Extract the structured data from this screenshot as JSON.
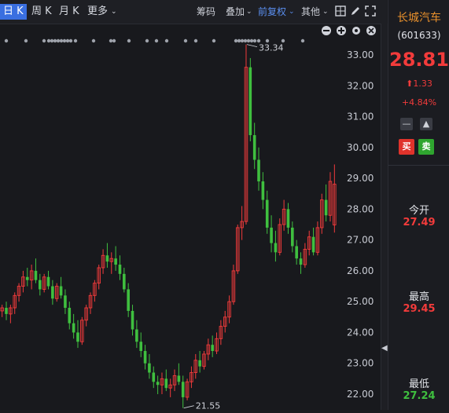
{
  "toolbar": {
    "tabs": [
      "日 K",
      "周 K",
      "月 K",
      "更多"
    ],
    "chips": "筹码",
    "overlay": "叠加",
    "adjust": "前复权",
    "other": "其他"
  },
  "stock": {
    "name": "长城汽车",
    "code": "(601633)",
    "price": "28.81",
    "change": "1.33",
    "change_pct": "+4.84%",
    "buy_label": "买",
    "sell_label": "卖",
    "open_label": "今开",
    "open_value": "27.49",
    "high_label": "最高",
    "high_value": "29.45",
    "low_label": "最低",
    "low_value": "27.24"
  },
  "colors": {
    "up": "#f23b3b",
    "down": "#3fbf3f",
    "accent": "#e8902c",
    "active_tab": "#3a6fe0"
  },
  "chart_data": {
    "type": "candlestick",
    "y_ticks": [
      "33.00",
      "32.00",
      "31.00",
      "30.00",
      "29.00",
      "28.00",
      "27.00",
      "26.00",
      "25.00",
      "24.00",
      "23.00",
      "22.00"
    ],
    "ylim": [
      21.6,
      33.6
    ],
    "max_label": "33.34",
    "min_label": "21.55",
    "candles": [
      [
        24.7,
        24.9,
        24.5,
        24.8
      ],
      [
        24.8,
        25.0,
        24.4,
        24.6
      ],
      [
        24.6,
        24.9,
        24.3,
        24.8
      ],
      [
        24.8,
        25.3,
        24.6,
        25.2
      ],
      [
        25.2,
        25.6,
        25.0,
        25.5
      ],
      [
        25.5,
        26.0,
        25.3,
        25.8
      ],
      [
        25.8,
        26.1,
        25.5,
        25.7
      ],
      [
        25.7,
        26.2,
        25.4,
        26.0
      ],
      [
        26.0,
        26.4,
        25.6,
        25.7
      ],
      [
        25.7,
        25.9,
        25.2,
        25.4
      ],
      [
        25.4,
        25.9,
        25.3,
        25.8
      ],
      [
        25.8,
        26.0,
        25.4,
        25.5
      ],
      [
        25.5,
        25.7,
        24.9,
        25.1
      ],
      [
        25.1,
        25.6,
        25.0,
        25.5
      ],
      [
        25.5,
        25.8,
        25.1,
        25.2
      ],
      [
        25.2,
        25.4,
        24.6,
        24.8
      ],
      [
        24.8,
        25.0,
        24.1,
        24.3
      ],
      [
        24.3,
        24.6,
        23.8,
        24.0
      ],
      [
        24.0,
        24.4,
        23.5,
        23.7
      ],
      [
        23.7,
        24.5,
        23.6,
        24.4
      ],
      [
        24.4,
        24.9,
        24.2,
        24.8
      ],
      [
        24.8,
        25.3,
        24.6,
        25.2
      ],
      [
        25.2,
        25.7,
        25.0,
        25.6
      ],
      [
        25.6,
        26.2,
        25.4,
        26.1
      ],
      [
        26.1,
        26.7,
        25.9,
        26.5
      ],
      [
        26.5,
        26.9,
        26.1,
        26.3
      ],
      [
        26.3,
        26.6,
        25.9,
        26.4
      ],
      [
        26.4,
        26.8,
        26.0,
        26.2
      ],
      [
        26.2,
        26.5,
        25.7,
        25.9
      ],
      [
        25.9,
        26.1,
        25.3,
        25.4
      ],
      [
        25.4,
        25.6,
        24.5,
        24.7
      ],
      [
        24.7,
        24.9,
        23.9,
        24.1
      ],
      [
        24.1,
        24.4,
        23.5,
        23.7
      ],
      [
        23.7,
        24.0,
        23.2,
        23.4
      ],
      [
        23.4,
        23.6,
        22.8,
        23.0
      ],
      [
        23.0,
        23.3,
        22.5,
        22.7
      ],
      [
        22.7,
        22.9,
        22.2,
        22.4
      ],
      [
        22.4,
        22.6,
        22.0,
        22.3
      ],
      [
        22.3,
        22.7,
        22.0,
        22.5
      ],
      [
        22.5,
        22.8,
        22.1,
        22.2
      ],
      [
        22.2,
        22.5,
        21.9,
        22.3
      ],
      [
        22.3,
        22.8,
        22.1,
        22.6
      ],
      [
        22.6,
        23.0,
        22.3,
        22.4
      ],
      [
        22.4,
        22.6,
        21.55,
        21.9
      ],
      [
        21.9,
        22.5,
        21.8,
        22.4
      ],
      [
        22.4,
        22.9,
        22.2,
        22.7
      ],
      [
        22.7,
        23.3,
        22.5,
        23.1
      ],
      [
        23.1,
        23.4,
        22.7,
        22.9
      ],
      [
        22.9,
        23.4,
        22.8,
        23.3
      ],
      [
        23.3,
        23.8,
        23.1,
        23.6
      ],
      [
        23.6,
        23.9,
        23.2,
        23.4
      ],
      [
        23.4,
        24.0,
        23.3,
        23.8
      ],
      [
        23.8,
        24.4,
        23.6,
        24.2
      ],
      [
        24.2,
        24.7,
        24.0,
        24.5
      ],
      [
        24.5,
        25.2,
        24.3,
        25.0
      ],
      [
        25.0,
        26.2,
        24.9,
        26.0
      ],
      [
        26.0,
        27.5,
        25.9,
        27.4
      ],
      [
        27.4,
        28.1,
        27.0,
        27.6
      ],
      [
        27.6,
        33.34,
        27.5,
        32.6
      ],
      [
        32.6,
        32.9,
        30.2,
        30.4
      ],
      [
        30.4,
        30.8,
        29.3,
        29.6
      ],
      [
        29.6,
        30.0,
        28.6,
        28.9
      ],
      [
        28.9,
        29.2,
        28.0,
        28.3
      ],
      [
        28.3,
        28.6,
        27.2,
        27.4
      ],
      [
        27.4,
        27.8,
        26.6,
        26.9
      ],
      [
        26.9,
        27.3,
        26.3,
        26.6
      ],
      [
        26.6,
        27.7,
        26.5,
        27.5
      ],
      [
        27.5,
        28.3,
        27.3,
        28.0
      ],
      [
        28.0,
        28.2,
        27.2,
        27.4
      ],
      [
        27.4,
        27.6,
        26.6,
        26.8
      ],
      [
        26.8,
        27.0,
        26.2,
        26.4
      ],
      [
        26.4,
        26.6,
        25.9,
        26.2
      ],
      [
        26.2,
        26.9,
        26.1,
        26.7
      ],
      [
        26.7,
        27.3,
        26.5,
        27.1
      ],
      [
        27.1,
        27.4,
        26.5,
        26.6
      ],
      [
        26.6,
        27.6,
        26.5,
        27.4
      ],
      [
        27.4,
        28.5,
        27.2,
        28.3
      ],
      [
        28.3,
        28.8,
        27.6,
        27.8
      ],
      [
        27.8,
        29.2,
        27.6,
        28.9
      ],
      [
        27.49,
        29.45,
        27.24,
        28.81
      ]
    ]
  }
}
